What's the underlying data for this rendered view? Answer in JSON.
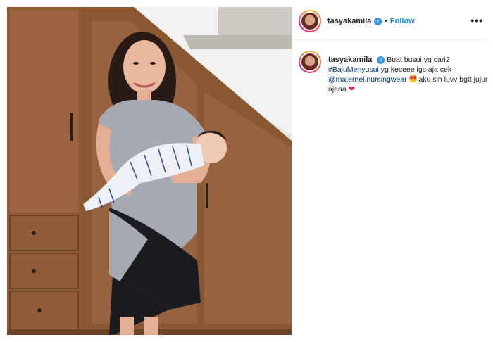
{
  "post": {
    "username": "tasyakamila",
    "follow_label": "Follow",
    "separator": "•",
    "more_label": "•••",
    "verified_glyph": "✓",
    "caption": {
      "text_1": "Buat busui yg cari2",
      "hashtag": "#BajuMenyusui",
      "text_2": "yg keceee lgs aja cek",
      "mention": "@maternel.nursingwear",
      "text_3": "aku sih luvv bgtt jujur ajaaa",
      "heart": "❤"
    },
    "icons": {
      "verified": "verified-badge-icon",
      "more": "more-options-icon",
      "emoji_1": "heart-eyes-emoji-icon",
      "emoji_2": "red-heart-emoji-icon"
    },
    "colors": {
      "link_blue": "#0095f6",
      "tag_blue": "#00376b",
      "verified_blue": "#3897f0"
    }
  }
}
